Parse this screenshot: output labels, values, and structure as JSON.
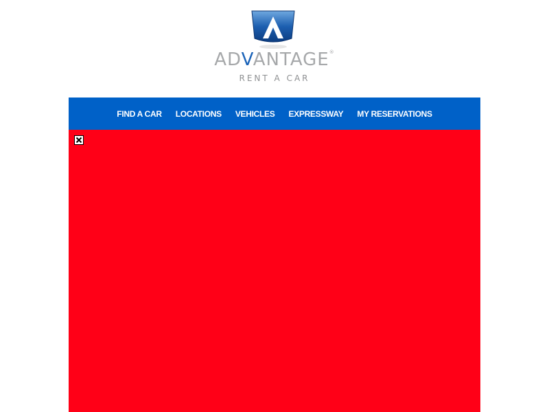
{
  "logo": {
    "wordmark_pre": "AD",
    "wordmark_accent": "V",
    "wordmark_post": "ANTAGE",
    "registered": "®",
    "tagline": "RENT A CAR",
    "emblem_icon": "advantage-emblem-icon"
  },
  "nav": {
    "items": [
      {
        "label": "FIND A CAR"
      },
      {
        "label": "LOCATIONS"
      },
      {
        "label": "VEHICLES"
      },
      {
        "label": "EXPRESSWAY"
      },
      {
        "label": "MY RESERVATIONS"
      }
    ]
  },
  "banner": {
    "close_icon": "close-icon"
  },
  "colors": {
    "nav_background": "#0061c8",
    "banner_background": "#ff0017",
    "logo_gray": "#a6a8aa",
    "logo_blue": "#1b63b8"
  }
}
